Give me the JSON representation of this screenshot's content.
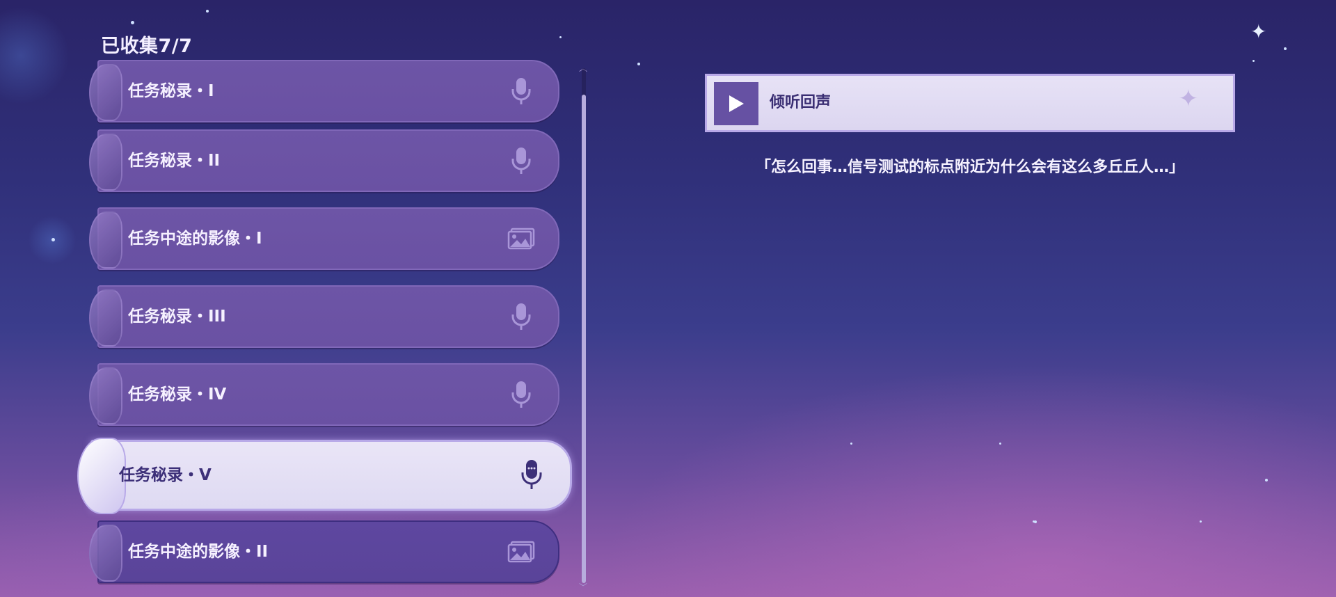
{
  "header": {
    "counter": "已收集7/7"
  },
  "list": {
    "items": [
      {
        "label": "任务秘录・I",
        "icon": "microphone-icon"
      },
      {
        "label": "任务秘录・II",
        "icon": "microphone-icon"
      },
      {
        "label": "任务中途的影像・I",
        "icon": "image-icon"
      },
      {
        "label": "任务秘录・III",
        "icon": "microphone-icon"
      },
      {
        "label": "任务秘录・IV",
        "icon": "microphone-icon"
      },
      {
        "label": "任务秘录・V",
        "icon": "microphone-icon",
        "selected": true
      },
      {
        "label": "任务中途的影像・II",
        "icon": "image-icon"
      }
    ]
  },
  "detail": {
    "play_label": "倾听回声",
    "quote": "「怎么回事…信号测试的标点附近为什么会有这么多丘丘人…」"
  },
  "colors": {
    "item_bg": "#6a51a3",
    "selected_bg": "#e7e2f6",
    "selected_text": "#3c2f78",
    "play_button": "#6651a3"
  }
}
